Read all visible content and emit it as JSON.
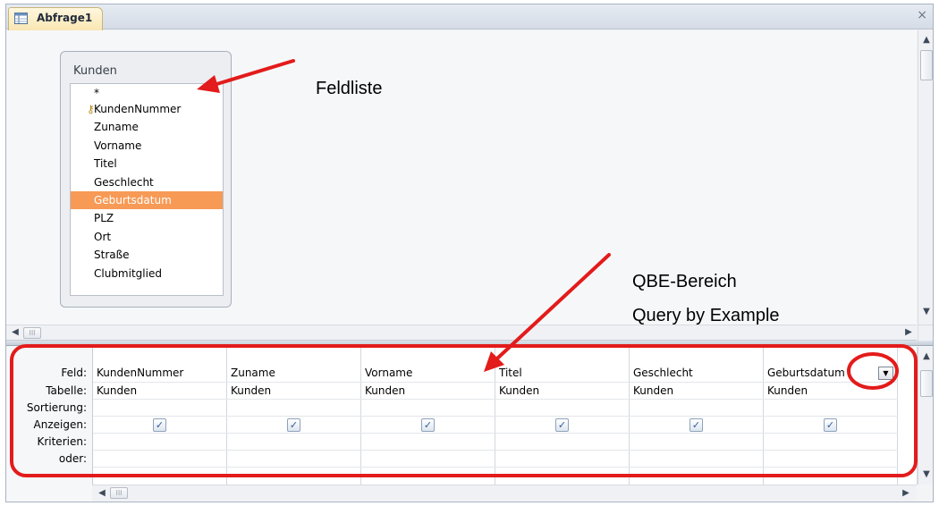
{
  "window": {
    "tab_title": "Abfrage1",
    "close_glyph": "×"
  },
  "field_list": {
    "table_name": "Kunden",
    "items": [
      {
        "label": "*",
        "key": false,
        "selected": false
      },
      {
        "label": "KundenNummer",
        "key": true,
        "selected": false
      },
      {
        "label": "Zuname",
        "key": false,
        "selected": false
      },
      {
        "label": "Vorname",
        "key": false,
        "selected": false
      },
      {
        "label": "Titel",
        "key": false,
        "selected": false
      },
      {
        "label": "Geschlecht",
        "key": false,
        "selected": false
      },
      {
        "label": "Geburtsdatum",
        "key": false,
        "selected": true
      },
      {
        "label": "PLZ",
        "key": false,
        "selected": false
      },
      {
        "label": "Ort",
        "key": false,
        "selected": false
      },
      {
        "label": "Straße",
        "key": false,
        "selected": false
      },
      {
        "label": "Clubmitglied",
        "key": false,
        "selected": false
      }
    ],
    "key_icon": "key-icon",
    "selected_color": "#f79a56"
  },
  "annotations": {
    "feldliste": "Feldliste",
    "qbe_line1": "QBE-Bereich",
    "qbe_line2": "Query by Example",
    "arrow_color": "#e31b1b"
  },
  "qbe": {
    "row_labels": {
      "feld": "Feld:",
      "tabelle": "Tabelle:",
      "sortierung": "Sortierung:",
      "anzeigen": "Anzeigen:",
      "kriterien": "Kriterien:",
      "oder": "oder:"
    },
    "columns": [
      {
        "feld": "KundenNummer",
        "tabelle": "Kunden",
        "anzeigen": true
      },
      {
        "feld": "Zuname",
        "tabelle": "Kunden",
        "anzeigen": true
      },
      {
        "feld": "Vorname",
        "tabelle": "Kunden",
        "anzeigen": true
      },
      {
        "feld": "Titel",
        "tabelle": "Kunden",
        "anzeigen": true
      },
      {
        "feld": "Geschlecht",
        "tabelle": "Kunden",
        "anzeigen": true
      },
      {
        "feld": "Geburtsdatum",
        "tabelle": "Kunden",
        "anzeigen": true
      }
    ],
    "check_glyph": "✓",
    "dropdown_glyph": "▼"
  },
  "scrollbars": {
    "up_glyph": "▲",
    "down_glyph": "▼",
    "left_glyph": "◀",
    "right_glyph": "▶",
    "thumb_grip": "III"
  }
}
